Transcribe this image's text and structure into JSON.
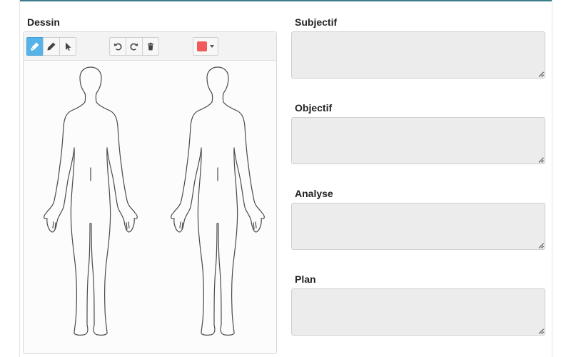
{
  "drawing": {
    "label": "Dessin",
    "tools": {
      "highlighter": "marker-icon",
      "pencil": "pencil-icon",
      "select": "cursor-icon",
      "undo": "undo-icon",
      "redo": "redo-icon",
      "delete": "trash-icon",
      "color_picker": "color-swatch"
    },
    "active_tool": "highlighter",
    "selected_color": "#f05a5a",
    "accent_color": "#55b3e8"
  },
  "notes": {
    "subjectif": {
      "label": "Subjectif",
      "value": "",
      "placeholder": ""
    },
    "objectif": {
      "label": "Objectif",
      "value": "",
      "placeholder": ""
    },
    "analyse": {
      "label": "Analyse",
      "value": "",
      "placeholder": ""
    },
    "plan": {
      "label": "Plan",
      "value": "",
      "placeholder": ""
    }
  }
}
